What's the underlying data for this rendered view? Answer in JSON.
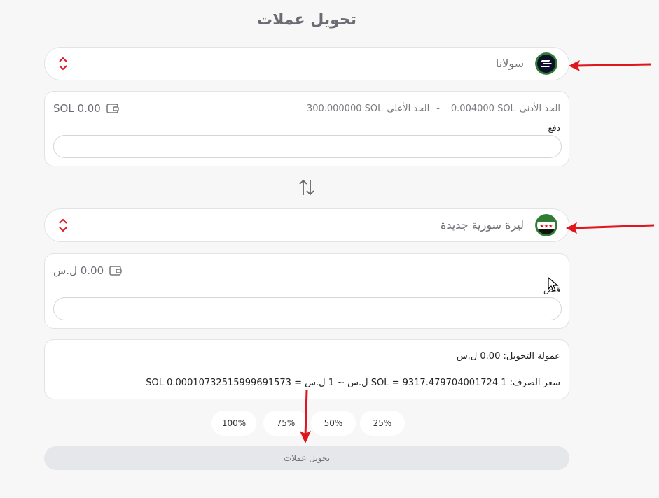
{
  "page": {
    "title": "تحويل عملات"
  },
  "from": {
    "currency_label": "سولانا",
    "limit_min_label": "الحد الأدنى",
    "limit_min_value": "0.004000 SOL",
    "limit_separator": "-",
    "limit_max_label": "الحد الأعلى",
    "limit_max_value": "300.000000 SOL",
    "balance": "SOL 0.00",
    "field_label": "دفع",
    "amount_value": ""
  },
  "to": {
    "currency_label": "ليرة سورية جديدة",
    "balance": "0.00 ل.س",
    "field_label": "قبض",
    "amount_value": ""
  },
  "info": {
    "fee": "عمولة التحويل: 0.00 ل.س",
    "rate": "سعر الصرف: 1 SOL = 9317.479704001724 ل.س ~ 1 ل.س = 0.00010732515999691573 SOL"
  },
  "percent_buttons": [
    "100%",
    "75%",
    "50%",
    "25%"
  ],
  "submit": {
    "label": "تحويل عملات"
  },
  "colors": {
    "accent_red": "#e0161f",
    "solana_bg": "#0e0f2b",
    "flag_green": "#2e7d32"
  }
}
